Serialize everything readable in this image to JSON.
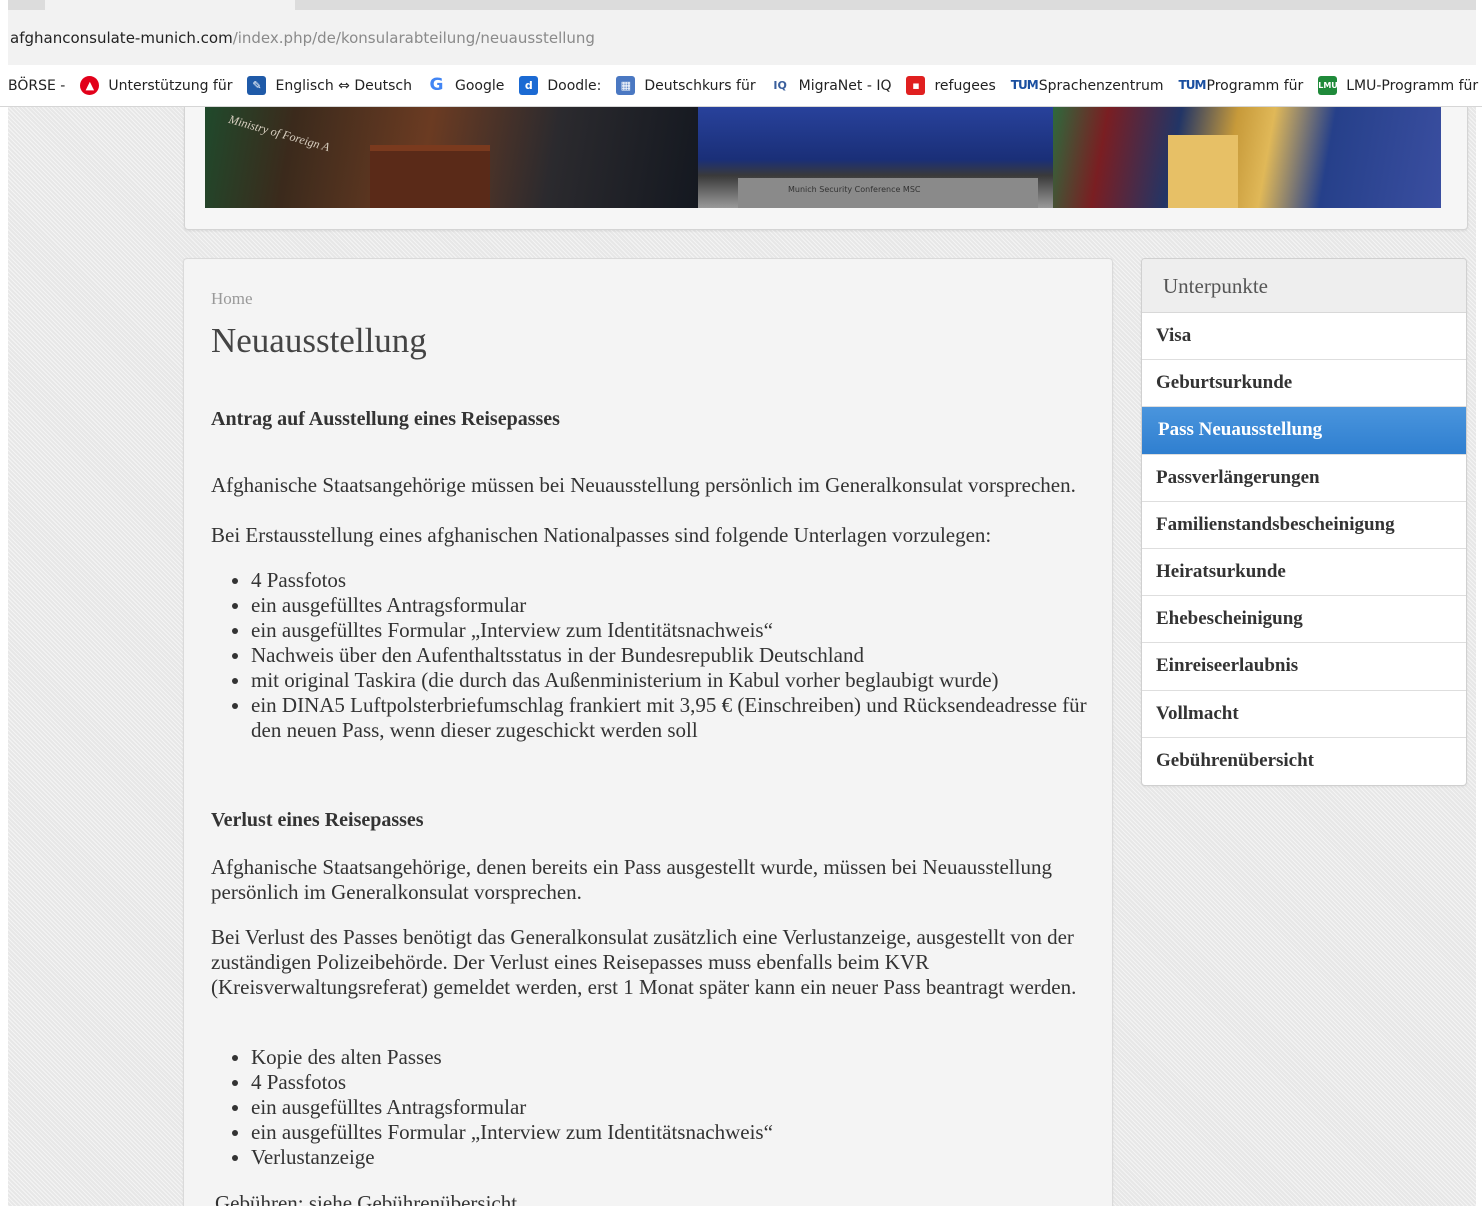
{
  "browser": {
    "url_domain": "afghanconsulate-munich.com",
    "url_path": "/index.php/de/konsularabteilung/neuausstellung",
    "bookmarks": [
      {
        "label": "BÖRSE -",
        "icon": "none"
      },
      {
        "label": "Unterstützung für",
        "icon": "employment-agency-icon",
        "color": "#e2001a"
      },
      {
        "label": "Englisch ⇔ Deutsch",
        "icon": "dictionary-icon",
        "color": "#1f5aa8"
      },
      {
        "label": "Google",
        "icon": "google-icon",
        "color": "#4285f4"
      },
      {
        "label": "Doodle:",
        "icon": "doodle-icon",
        "color": "#1b6ad3"
      },
      {
        "label": "Deutschkurs für",
        "icon": "course-icon",
        "color": "#4a78c2"
      },
      {
        "label": "MigraNet - IQ",
        "icon": "migranet-icon",
        "color": "#3a5f9c"
      },
      {
        "label": "refugees",
        "icon": "refugees-icon",
        "color": "#e02020"
      },
      {
        "label": "Sprachenzentrum",
        "icon": "tum-icon",
        "color": "#1a4fa0"
      },
      {
        "label": "Programm für",
        "icon": "tum-icon",
        "color": "#1a4fa0"
      },
      {
        "label": "LMU-Programm für",
        "icon": "lmu-icon",
        "color": "#1f8a3a"
      },
      {
        "label": "",
        "icon": "diamond-icon",
        "color": "#8b1a1a"
      }
    ]
  },
  "banner": {
    "text_left": "Ministry of Foreign A",
    "text_mid": "Munich Security Conference MSC"
  },
  "content": {
    "breadcrumb": "Home",
    "title": "Neuausstellung",
    "section1_heading": "Antrag auf Ausstellung eines Reisepasses",
    "section1_para1": "Afghanische Staatsangehörige müssen bei Neuausstellung persönlich im Generalkonsulat vorsprechen.",
    "section1_para2": "Bei Erstausstellung eines afghanischen Nationalpasses sind folgende Unterlagen vorzulegen:",
    "section1_list": [
      "4 Passfotos",
      "ein ausgefülltes Antragsformular",
      "ein ausgefülltes Formular „Interview zum Identitätsnachweis“",
      "Nachweis über den Aufenthaltsstatus in der Bundesrepublik Deutschland",
      "mit original Taskira  (die durch das Außenministerium in Kabul vorher beglaubigt wurde)",
      "ein DINA5 Luftpolsterbriefumschlag frankiert mit 3,95 € (Einschreiben) und Rücksendeadresse für den neuen Pass, wenn dieser zugeschickt werden soll"
    ],
    "section2_heading": "Verlust eines Reisepasses",
    "section2_para1": "Afghanische Staatsangehörige, denen bereits ein Pass ausgestellt wurde, müssen bei Neuausstellung persönlich im Generalkonsulat vorsprechen.",
    "section2_para2": "Bei Verlust des Passes benötigt das Generalkonsulat zusätzlich eine Verlustanzeige, ausgestellt von der zuständigen Polizeibehörde. Der Verlust eines Reisepasses muss ebenfalls beim KVR (Kreisverwaltungsreferat) gemeldet werden, erst 1 Monat später kann ein neuer Pass beantragt werden.",
    "section2_list": [
      "Kopie des alten Passes",
      "4 Passfotos",
      "ein ausgefülltes Antragsformular",
      "ein ausgefülltes Formular „Interview zum Identitätsnachweis“",
      "Verlustanzeige"
    ],
    "fees_text": "Gebühren: siehe Gebührenübersicht"
  },
  "sidebar": {
    "header": "Unterpunkte",
    "items": [
      {
        "label": "Visa",
        "active": false
      },
      {
        "label": "Geburtsurkunde",
        "active": false
      },
      {
        "label": "Pass Neuausstellung",
        "active": true
      },
      {
        "label": "Passverlängerungen",
        "active": false
      },
      {
        "label": "Familienstandsbescheinigung",
        "active": false
      },
      {
        "label": "Heiratsurkunde",
        "active": false
      },
      {
        "label": "Ehebescheinigung",
        "active": false
      },
      {
        "label": "Einreiseerlaubnis",
        "active": false
      },
      {
        "label": "Vollmacht",
        "active": false
      },
      {
        "label": "Gebührenübersicht",
        "active": false
      }
    ],
    "active_color": "#3a88d6"
  }
}
